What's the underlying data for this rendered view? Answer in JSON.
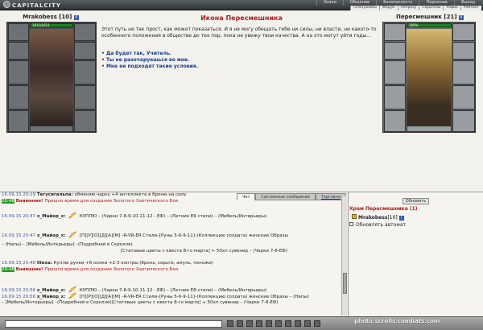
{
  "app": {
    "logo": "CAPITALCITY"
  },
  "topmenu": [
    "Знаки",
    "Общение",
    "Безопасность",
    "Персонаж",
    "Выход"
  ],
  "submenu": [
    "Телеграммы",
    "Форум",
    "Лепрозу",
    "Скроллзы",
    "Радио",
    "Рейтинг"
  ],
  "player": {
    "name": "Mrakobess",
    "level": "[10]",
    "hp": "1611/1611"
  },
  "npc": {
    "name": "Пересмешник",
    "level": "[21]",
    "hp": "100%"
  },
  "dialog": {
    "title": "Икона Пересмешника",
    "text": "Этот путь не так прост, как может показаться. И я не могу обещать тебе ни силы, ни власти, ни какого-то особенного положения в обществе до тех пор, пока не увижу твои качества. А на это могут уйти годы...",
    "options": [
      "Да будет так, Учитель.",
      "Ты не разочаруешься во мне.",
      "Мне не подходят такие условия."
    ]
  },
  "chat": {
    "tabs": [
      "Чат",
      "Системные сообщения",
      "Торговля"
    ],
    "messages": [
      {
        "ts": "16.09.15 20:19",
        "nick": "Тегусигальпа:",
        "text": "обменяю чарку +4 интеллекта в броню на силу"
      },
      {
        "ts": "20:48",
        "warn": "Внимание!",
        "text": "Пришло время для создания Золотого Хаотического Боя"
      },
      {
        "ts": "16.09.15 20:47",
        "nick": "х_Майор_х:",
        "text": "КУПЛЮ – (Чарки 7-8-9-10-11-12 - ЕФ) – (Летние ЕR стили) – (Мебель/Интерьеры)"
      },
      {
        "ts": "16.09.15 20:47",
        "nick": "х_Майор_х:",
        "text": "[П][Р][О][Д][А][М] –R-VR-ER Стили–[Руны 5-6-9-11]–(Коллекцию солдата) женские Образы"
      },
      {
        "ts": "",
        "text": "– (Напы) – [Мебель/Интерьеры] –(Подробней в Скролле)"
      },
      {
        "ts": "",
        "text": "[Статовые цветы с квеста 8-го марта] + 50хп сувенир – (Чарки 7-8-ЕФ)"
      },
      {
        "ts": "16.09.15 20:48",
        "nick": "Illexa:",
        "text": "Куплю рунки +6 колки +2-3 контры.(бронь, серьги, амуль, поножи)"
      },
      {
        "ts": "20:48",
        "warn": "Внимание!",
        "text": "Пришло время для создания Золотого Хаотического Боя"
      },
      {
        "ts": "16.09.15 20:56",
        "nick": "х_Майор_х:",
        "text": "КУПЛЮ – (Чарки 7-8-9-10-11-12 - ЕФ) – (Летние ЕR стили) – (Мебель/Интерьеры)"
      },
      {
        "ts": "16.09.15 20:56",
        "nick": "х_Майор_х:",
        "text": "[П][Р][О][Д][А][М] –R-VR-ER Стили–[Руны 5-6-9-11]–(Коллекцию солдата) женские Образы – (Напы)"
      },
      {
        "ts": "",
        "text": "– [Мебель/Интерьеры] –(Подробней в Скролле)[Статовые цветы с квеста 8-го марта] + 50хп сувенир – (Чарки 7-8-ЕФ)"
      }
    ]
  },
  "users": {
    "refresh_label": "Обновить",
    "location": "Храм Пересмешника (1)",
    "user_name": "Mrakobess",
    "user_level": "[10]",
    "auto_label": "Обновлять автомат."
  },
  "watermark": "photo.scrolls.combats.com"
}
